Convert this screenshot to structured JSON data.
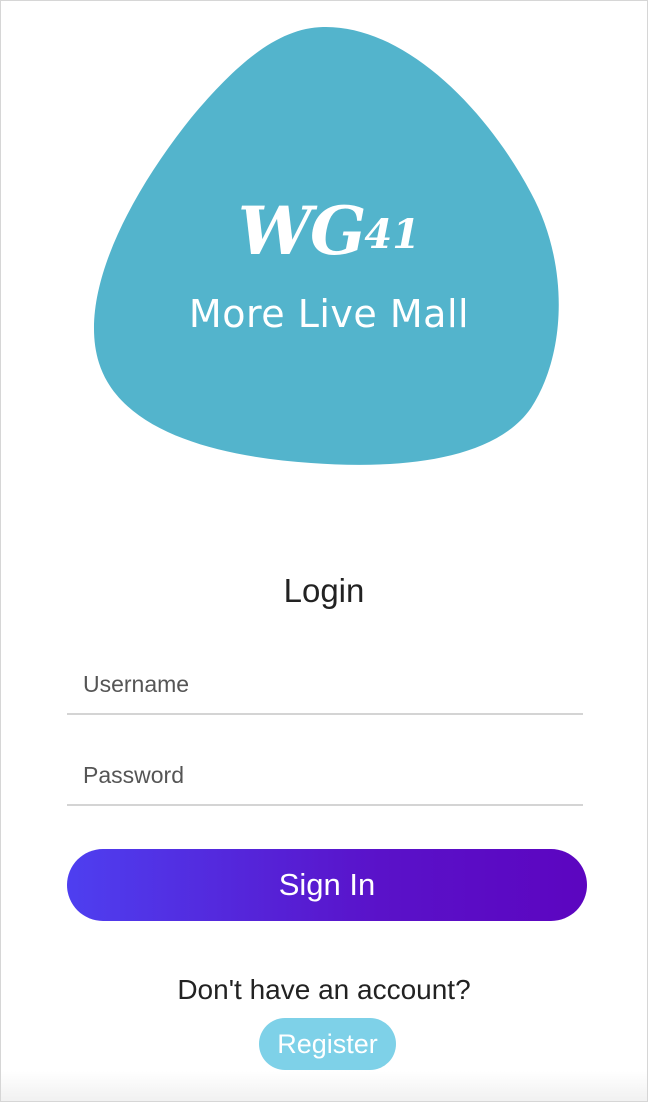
{
  "brand": {
    "logo_text": "WG",
    "logo_number": "41",
    "tagline": "More Live Mall",
    "blob_color": "#53b4cc"
  },
  "login": {
    "title": "Login",
    "username_placeholder": "Username",
    "username_value": "",
    "password_placeholder": "Password",
    "password_value": "",
    "signin_label": "Sign In",
    "signin_gradient": [
      "#4e3ff0",
      "#5c05c0"
    ]
  },
  "register": {
    "prompt": "Don't have an account?",
    "button_label": "Register",
    "button_color": "#7ed1e8"
  }
}
